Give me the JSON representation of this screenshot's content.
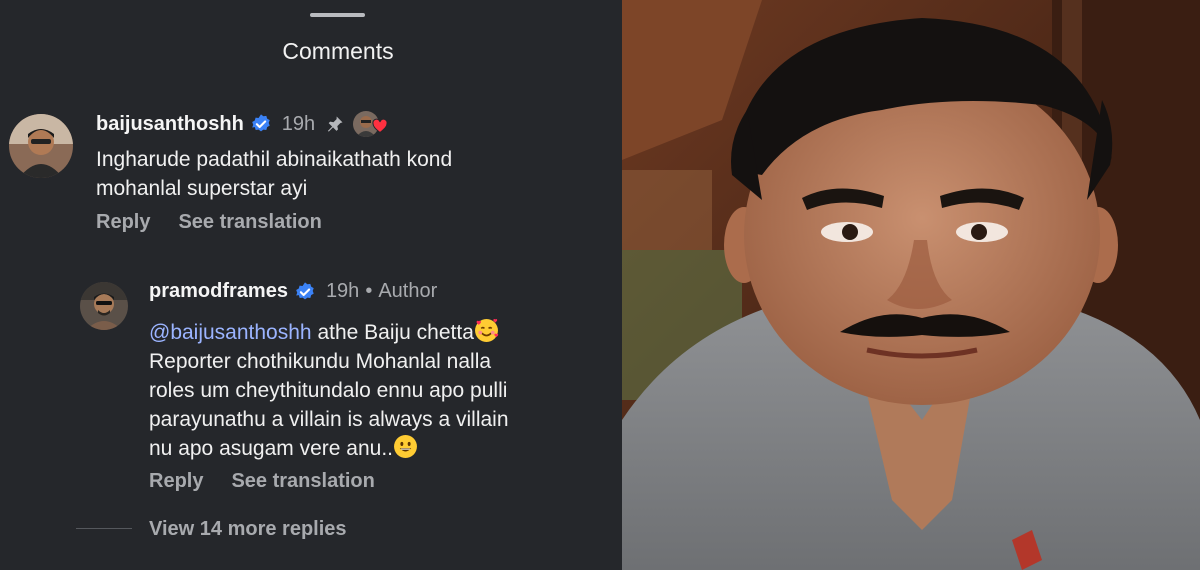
{
  "sheet": {
    "title": "Comments"
  },
  "comments": [
    {
      "username": "baijusanthoshh",
      "time": "19h",
      "text": "Ingharude padathil abinaikathath kond\nmohanlal superstar ayi",
      "reply_label": "Reply",
      "translate_label": "See translation",
      "pinned": true,
      "liked_by_author": true
    }
  ],
  "reply": {
    "username": "pramodframes",
    "time": "19h",
    "dot": "•",
    "author_label": "Author",
    "mention": "@baijusanthoshh",
    "text_first": " athe Baiju chetta",
    "text_rest": "Reporter chothikundu Mohanlal nalla\nroles um cheythitundalo ennu apo pulli\nparayunathu a villain is always a villain\nnu apo asugam vere anu..",
    "reply_label": "Reply",
    "translate_label": "See translation"
  },
  "view_more": "View 14 more replies",
  "icons": {
    "verified": "verified-badge-icon",
    "pin": "pin-icon",
    "heart": "heart-icon",
    "emoji_hearts": "smiling-face-with-hearts-emoji",
    "emoji_smile": "grinning-face-emoji"
  },
  "colors": {
    "background": "#25272b",
    "verified": "#3b82f6",
    "mention": "#9bb4ff",
    "secondary_text": "#a8aaae",
    "heart": "#ff3040"
  }
}
